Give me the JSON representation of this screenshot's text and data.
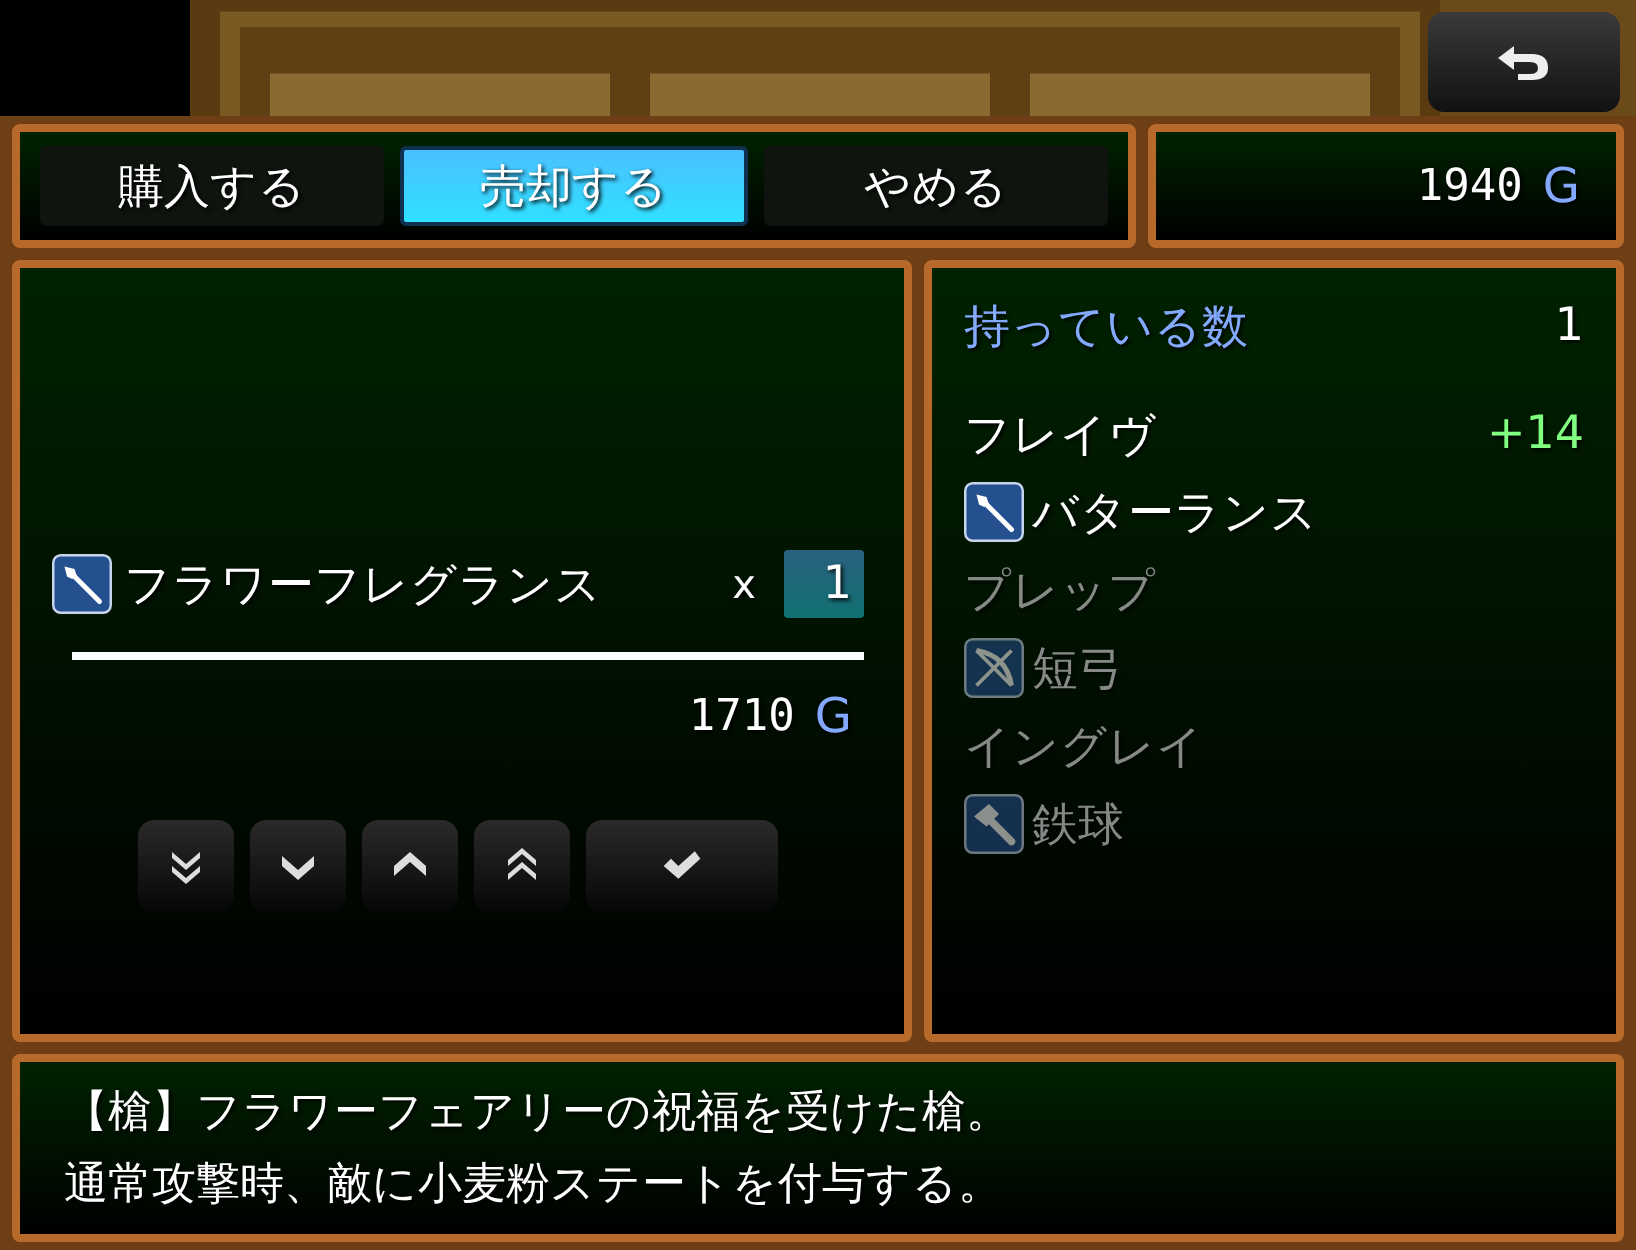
{
  "commands": [
    {
      "label": "購入する",
      "selected": false
    },
    {
      "label": "売却する",
      "selected": true
    },
    {
      "label": "やめる",
      "selected": false
    }
  ],
  "gold": {
    "amount": "1940",
    "unit": "G"
  },
  "item": {
    "kind": "spear",
    "name": "フラワーフレグランス",
    "times": "x",
    "quantity": "1"
  },
  "total": {
    "amount": "1710",
    "unit": "G"
  },
  "status": {
    "possession_label": "持っている数",
    "possession": "1",
    "actors": [
      {
        "name": "フレイヴ",
        "equippable": true,
        "change": "+14",
        "weapon": {
          "kind": "spear",
          "name": "バターランス"
        }
      },
      {
        "name": "プレップ",
        "equippable": false,
        "weapon": {
          "kind": "bow",
          "name": "短弓"
        }
      },
      {
        "name": "イングレイ",
        "equippable": false,
        "weapon": {
          "kind": "axe",
          "name": "鉄球"
        }
      }
    ]
  },
  "help": [
    "【槍】フラワーフェアリーの祝福を受けた槍。",
    "通常攻撃時、敵に小麦粉ステートを付与する。"
  ]
}
